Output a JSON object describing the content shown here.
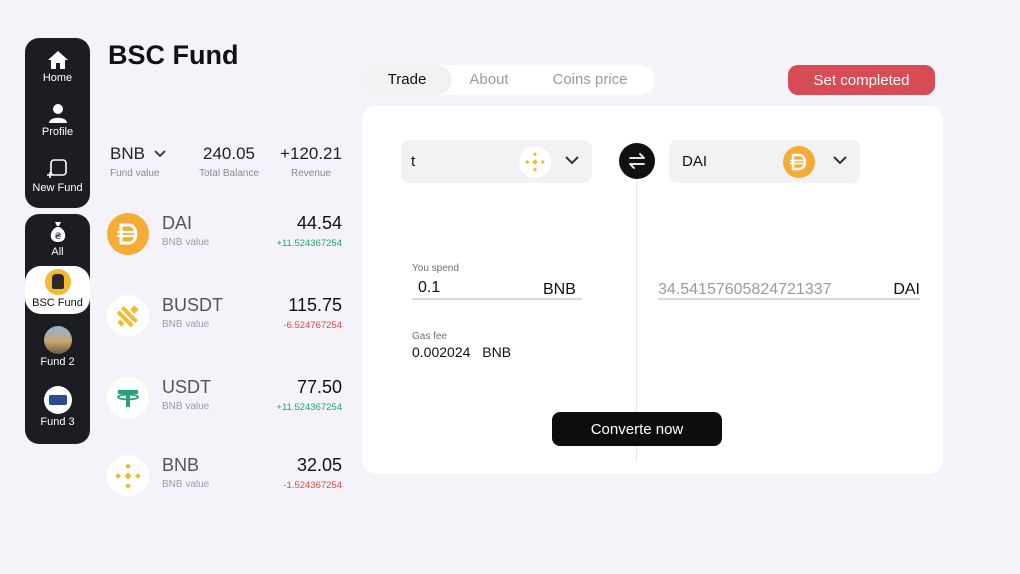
{
  "nav": {
    "home": "Home",
    "profile": "Profile",
    "new_fund": "New Fund",
    "all": "All",
    "funds": [
      "BSC Fund",
      "Fund 2",
      "Fund 3"
    ]
  },
  "page": {
    "title": "BSC Fund"
  },
  "summary": {
    "currency": "BNB",
    "currency_sub": "Fund value",
    "total_balance": "240.05",
    "total_balance_sub": "Total Balance",
    "revenue": "+120.21",
    "revenue_sub": "Revenue"
  },
  "coins": [
    {
      "name": "DAI",
      "sub": "BNB value",
      "amount": "44.54",
      "change": "+11.524367254",
      "icon": "dai-icon"
    },
    {
      "name": "BUSDT",
      "sub": "BNB value",
      "amount": "115.75",
      "change": "-6.524767254",
      "icon": "busd-icon"
    },
    {
      "name": "USDT",
      "sub": "BNB value",
      "amount": "77.50",
      "change": "+11.524367254",
      "icon": "tether-icon"
    },
    {
      "name": "BNB",
      "sub": "BNB value",
      "amount": "32.05",
      "change": "-1.524367254",
      "icon": "bnb-icon"
    }
  ],
  "tabs": [
    "Trade",
    "About",
    "Coins price"
  ],
  "actions": {
    "set_completed": "Set completed",
    "convert": "Converte now"
  },
  "trade": {
    "from_value": "t",
    "to_value": "DAI",
    "spend_label": "You spend",
    "spend_amount": "0.1",
    "spend_unit": "BNB",
    "receive_amount": "34.54157605824721337",
    "receive_unit": "DAI",
    "gas_label": "Gas fee",
    "gas_value": "0.002024",
    "gas_unit": "BNB"
  },
  "colors": {
    "accent_red": "#d64b55",
    "positive": "#1fa56b",
    "negative": "#e24848",
    "bnb_yellow": "#f3ba2f",
    "dai_orange": "#f5ac37",
    "usdt_green": "#26a17b"
  }
}
